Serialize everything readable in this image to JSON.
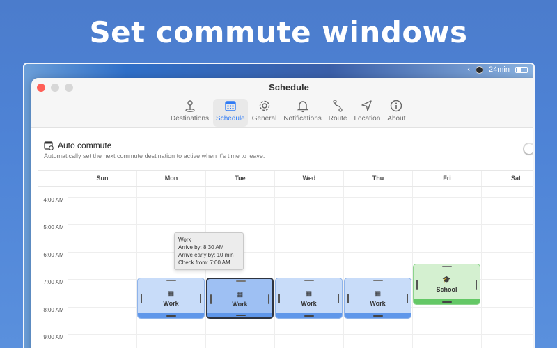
{
  "headline": "Set commute windows",
  "menubar": {
    "back_glyph": "‹",
    "duration": "24min"
  },
  "window": {
    "title": "Schedule"
  },
  "tabs": [
    {
      "label": "Destinations",
      "icon": "map-pin-icon"
    },
    {
      "label": "Schedule",
      "icon": "calendar-icon",
      "active": true
    },
    {
      "label": "General",
      "icon": "gear-icon"
    },
    {
      "label": "Notifications",
      "icon": "bell-icon"
    },
    {
      "label": "Route",
      "icon": "route-icon"
    },
    {
      "label": "Location",
      "icon": "location-arrow-icon"
    },
    {
      "label": "About",
      "icon": "info-icon"
    }
  ],
  "auto_commute": {
    "title": "Auto commute",
    "description": "Automatically set the next commute destination to active when it's time to leave.",
    "enabled": false
  },
  "calendar": {
    "days": [
      "Sun",
      "Mon",
      "Tue",
      "Wed",
      "Thu",
      "Fri",
      "Sat"
    ],
    "times": [
      "4:00 AM",
      "5:00 AM",
      "6:00 AM",
      "7:00 AM",
      "8:00 AM",
      "9:00 AM"
    ],
    "events": [
      {
        "day": "Mon",
        "label": "Work",
        "icon": "building-icon"
      },
      {
        "day": "Tue",
        "label": "Work",
        "icon": "building-icon",
        "selected": true
      },
      {
        "day": "Wed",
        "label": "Work",
        "icon": "building-icon"
      },
      {
        "day": "Thu",
        "label": "Work",
        "icon": "building-icon"
      },
      {
        "day": "Fri",
        "label": "School",
        "icon": "graduation-cap-icon"
      }
    ],
    "tooltip": {
      "title": "Work",
      "arrive_by": "Arrive by: 8:30 AM",
      "arrive_early": "Arrive early by: 10 min",
      "check_from": "Check from: 7:00 AM"
    }
  },
  "colors": {
    "accent": "#2f7bf5",
    "work_event": "#c8dcf9",
    "school_event": "#d4f0d0"
  }
}
